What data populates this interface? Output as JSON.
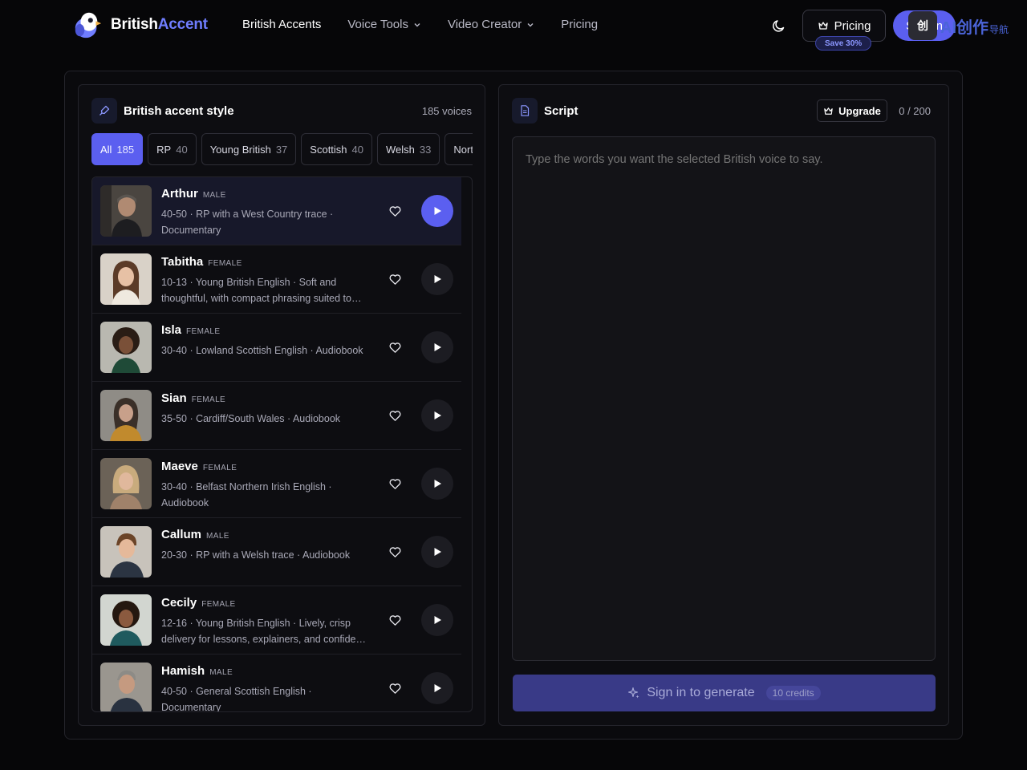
{
  "brand": {
    "name_part1": "British",
    "name_part2": "Accent"
  },
  "nav": {
    "items": [
      {
        "label": "British Accents",
        "active": true,
        "dropdown": false
      },
      {
        "label": "Voice Tools",
        "active": false,
        "dropdown": true
      },
      {
        "label": "Video Creator",
        "active": false,
        "dropdown": true
      },
      {
        "label": "Pricing",
        "active": false,
        "dropdown": false
      }
    ]
  },
  "header": {
    "pricing_label": "Pricing",
    "save_badge": "Save 30%",
    "signin_label": "Sign in",
    "watermark_text": "AI创作",
    "watermark_sub": "导航"
  },
  "voices_panel": {
    "title": "British accent style",
    "count_label": "185 voices",
    "filters": [
      {
        "label": "All",
        "count": "185",
        "active": true
      },
      {
        "label": "RP",
        "count": "40",
        "active": false
      },
      {
        "label": "Young British",
        "count": "37",
        "active": false
      },
      {
        "label": "Scottish",
        "count": "40",
        "active": false
      },
      {
        "label": "Welsh",
        "count": "33",
        "active": false
      },
      {
        "label": "Northern",
        "count": "",
        "active": false
      }
    ],
    "voices": [
      {
        "name": "Arthur",
        "gender": "MALE",
        "desc": "40-50 · RP with a West Country trace · Documentary",
        "selected": true
      },
      {
        "name": "Tabitha",
        "gender": "FEMALE",
        "desc": "10-13 · Young British English · Soft and thoughtful, with compact phrasing suited to…",
        "selected": false
      },
      {
        "name": "Isla",
        "gender": "FEMALE",
        "desc": "30-40 · Lowland Scottish English · Audiobook",
        "selected": false
      },
      {
        "name": "Sian",
        "gender": "FEMALE",
        "desc": "35-50 · Cardiff/South Wales · Audiobook",
        "selected": false
      },
      {
        "name": "Maeve",
        "gender": "FEMALE",
        "desc": "30-40 · Belfast Northern Irish English · Audiobook",
        "selected": false
      },
      {
        "name": "Callum",
        "gender": "MALE",
        "desc": "20-30 · RP with a Welsh trace · Audiobook",
        "selected": false
      },
      {
        "name": "Cecily",
        "gender": "FEMALE",
        "desc": "12-16 · Young British English · Lively, crisp delivery for lessons, explainers, and confide…",
        "selected": false
      },
      {
        "name": "Hamish",
        "gender": "MALE",
        "desc": "40-50 · General Scottish English · Documentary",
        "selected": false
      }
    ]
  },
  "script_panel": {
    "title": "Script",
    "upgrade_label": "Upgrade",
    "char_count": "0 / 200",
    "placeholder": "Type the words you want the selected British voice to say.",
    "generate_label": "Sign in to generate",
    "credits_label": "10 credits"
  },
  "colors": {
    "accent": "#5b5ff0",
    "background": "#060608",
    "panel": "#0d0d11"
  }
}
